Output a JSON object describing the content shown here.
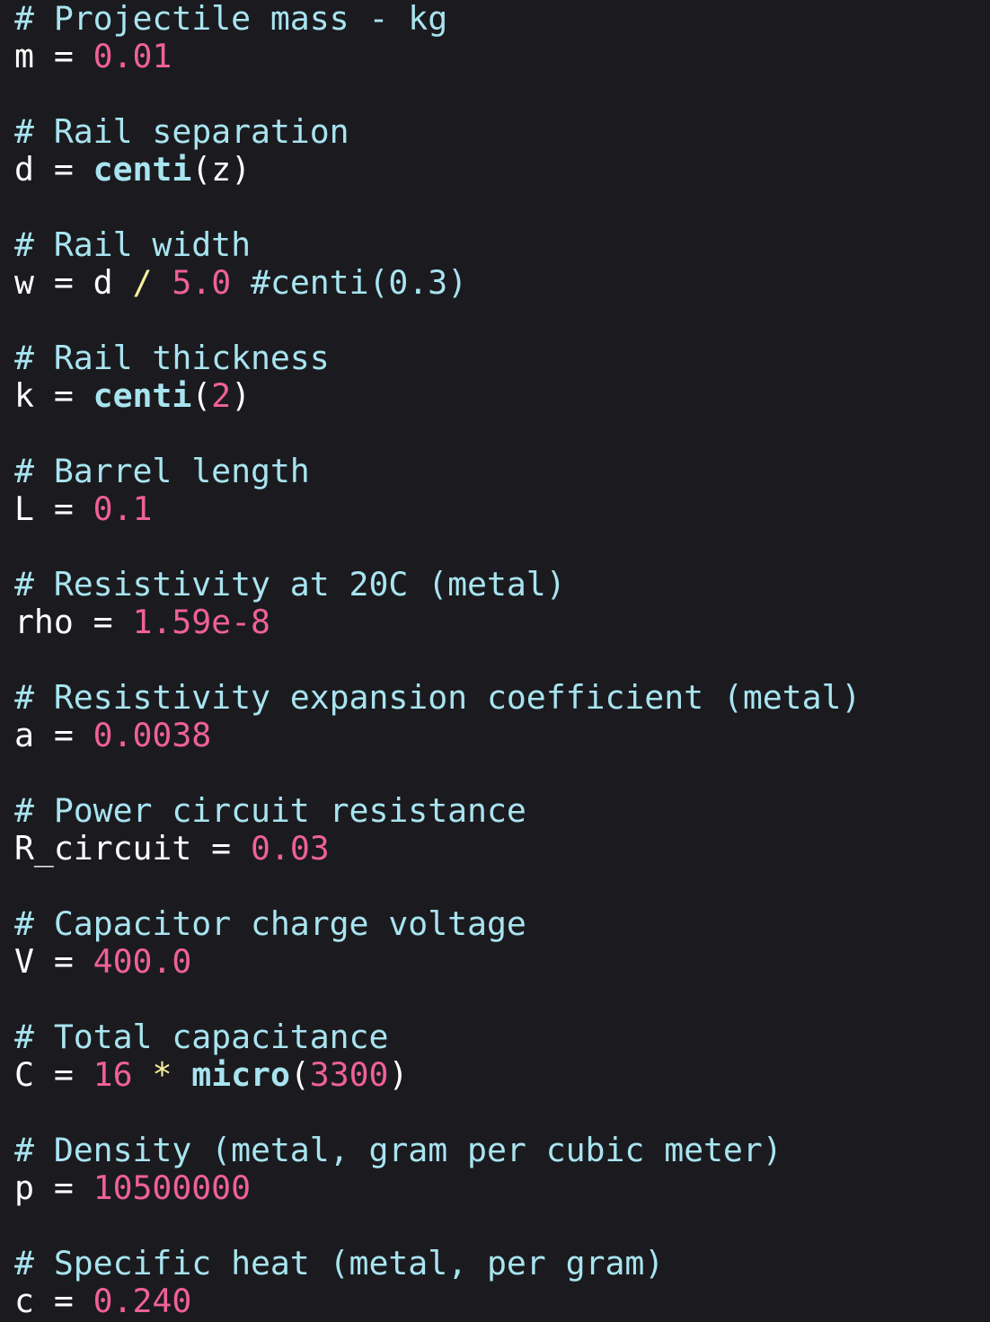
{
  "editor": {
    "colors": {
      "background": "#1b1b1f",
      "comment": "#a8e4f0",
      "number": "#f0609a",
      "function": "#a8e4f0",
      "operator_accent": "#f8f0a0",
      "default": "#ffffff"
    },
    "lines": [
      [
        {
          "t": "# Projectile mass - kg",
          "c": "comment"
        }
      ],
      [
        {
          "t": "m",
          "c": "var"
        },
        {
          "t": " = ",
          "c": "op"
        },
        {
          "t": "0.01",
          "c": "number"
        }
      ],
      [],
      [
        {
          "t": "# Rail separation",
          "c": "comment"
        }
      ],
      [
        {
          "t": "d",
          "c": "var"
        },
        {
          "t": " = ",
          "c": "op"
        },
        {
          "t": "centi",
          "c": "func"
        },
        {
          "t": "(z)",
          "c": "punct"
        }
      ],
      [],
      [
        {
          "t": "# Rail width",
          "c": "comment"
        }
      ],
      [
        {
          "t": "w",
          "c": "var"
        },
        {
          "t": " = ",
          "c": "op"
        },
        {
          "t": "d",
          "c": "var"
        },
        {
          "t": " ",
          "c": "op"
        },
        {
          "t": "/",
          "c": "op-accent"
        },
        {
          "t": " ",
          "c": "op"
        },
        {
          "t": "5.0",
          "c": "number"
        },
        {
          "t": " #centi(0.3)",
          "c": "comment"
        }
      ],
      [],
      [
        {
          "t": "# Rail thickness",
          "c": "comment"
        }
      ],
      [
        {
          "t": "k",
          "c": "var"
        },
        {
          "t": " = ",
          "c": "op"
        },
        {
          "t": "centi",
          "c": "func"
        },
        {
          "t": "(",
          "c": "punct"
        },
        {
          "t": "2",
          "c": "number"
        },
        {
          "t": ")",
          "c": "punct"
        }
      ],
      [],
      [
        {
          "t": "# Barrel length",
          "c": "comment"
        }
      ],
      [
        {
          "t": "L",
          "c": "var"
        },
        {
          "t": " = ",
          "c": "op"
        },
        {
          "t": "0.1",
          "c": "number"
        }
      ],
      [],
      [
        {
          "t": "# Resistivity at 20C (metal)",
          "c": "comment"
        }
      ],
      [
        {
          "t": "rho",
          "c": "var"
        },
        {
          "t": " = ",
          "c": "op"
        },
        {
          "t": "1.59e-8",
          "c": "number"
        }
      ],
      [],
      [
        {
          "t": "# Resistivity expansion coefficient (metal)",
          "c": "comment"
        }
      ],
      [
        {
          "t": "a",
          "c": "var"
        },
        {
          "t": " = ",
          "c": "op"
        },
        {
          "t": "0.0038",
          "c": "number"
        }
      ],
      [],
      [
        {
          "t": "# Power circuit resistance",
          "c": "comment"
        }
      ],
      [
        {
          "t": "R_circuit",
          "c": "var"
        },
        {
          "t": " = ",
          "c": "op"
        },
        {
          "t": "0.03",
          "c": "number"
        }
      ],
      [],
      [
        {
          "t": "# Capacitor charge voltage",
          "c": "comment"
        }
      ],
      [
        {
          "t": "V",
          "c": "var"
        },
        {
          "t": " = ",
          "c": "op"
        },
        {
          "t": "400.0",
          "c": "number"
        }
      ],
      [],
      [
        {
          "t": "# Total capacitance",
          "c": "comment"
        }
      ],
      [
        {
          "t": "C",
          "c": "var"
        },
        {
          "t": " = ",
          "c": "op"
        },
        {
          "t": "16",
          "c": "number"
        },
        {
          "t": " ",
          "c": "op"
        },
        {
          "t": "*",
          "c": "op-accent"
        },
        {
          "t": " ",
          "c": "op"
        },
        {
          "t": "micro",
          "c": "func"
        },
        {
          "t": "(",
          "c": "punct"
        },
        {
          "t": "3300",
          "c": "number"
        },
        {
          "t": ")",
          "c": "punct"
        }
      ],
      [],
      [
        {
          "t": "# Density (metal, gram per cubic meter)",
          "c": "comment"
        }
      ],
      [
        {
          "t": "p",
          "c": "var"
        },
        {
          "t": " = ",
          "c": "op"
        },
        {
          "t": "10500000",
          "c": "number"
        }
      ],
      [],
      [
        {
          "t": "# Specific heat (metal, per gram)",
          "c": "comment"
        }
      ],
      [
        {
          "t": "c",
          "c": "var"
        },
        {
          "t": " = ",
          "c": "op"
        },
        {
          "t": "0.240",
          "c": "number"
        }
      ]
    ]
  }
}
